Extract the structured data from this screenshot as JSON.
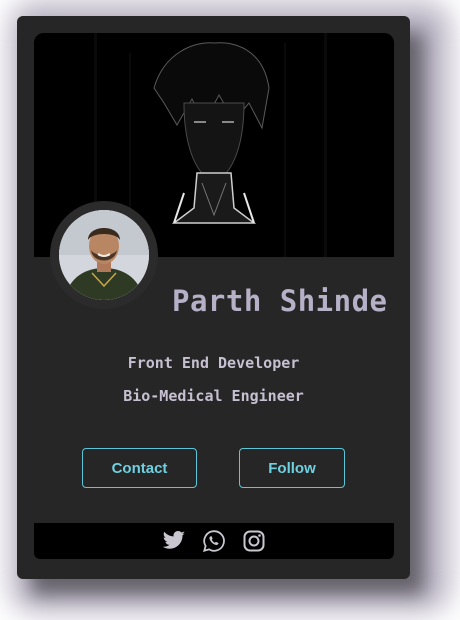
{
  "profile": {
    "name": "Parth Shinde",
    "roles": [
      "Front End Developer",
      "Bio-Medical Engineer"
    ]
  },
  "buttons": {
    "contact_label": "Contact",
    "follow_label": "Follow"
  },
  "social": [
    {
      "icon": "twitter-icon"
    },
    {
      "icon": "whatsapp-icon"
    },
    {
      "icon": "instagram-icon"
    }
  ],
  "colors": {
    "card_bg": "#262626",
    "accent": "#5cc6d8",
    "name_color": "#b7b1c8",
    "text_color": "#c6c0d0",
    "icon_color": "#c9c6cf"
  }
}
